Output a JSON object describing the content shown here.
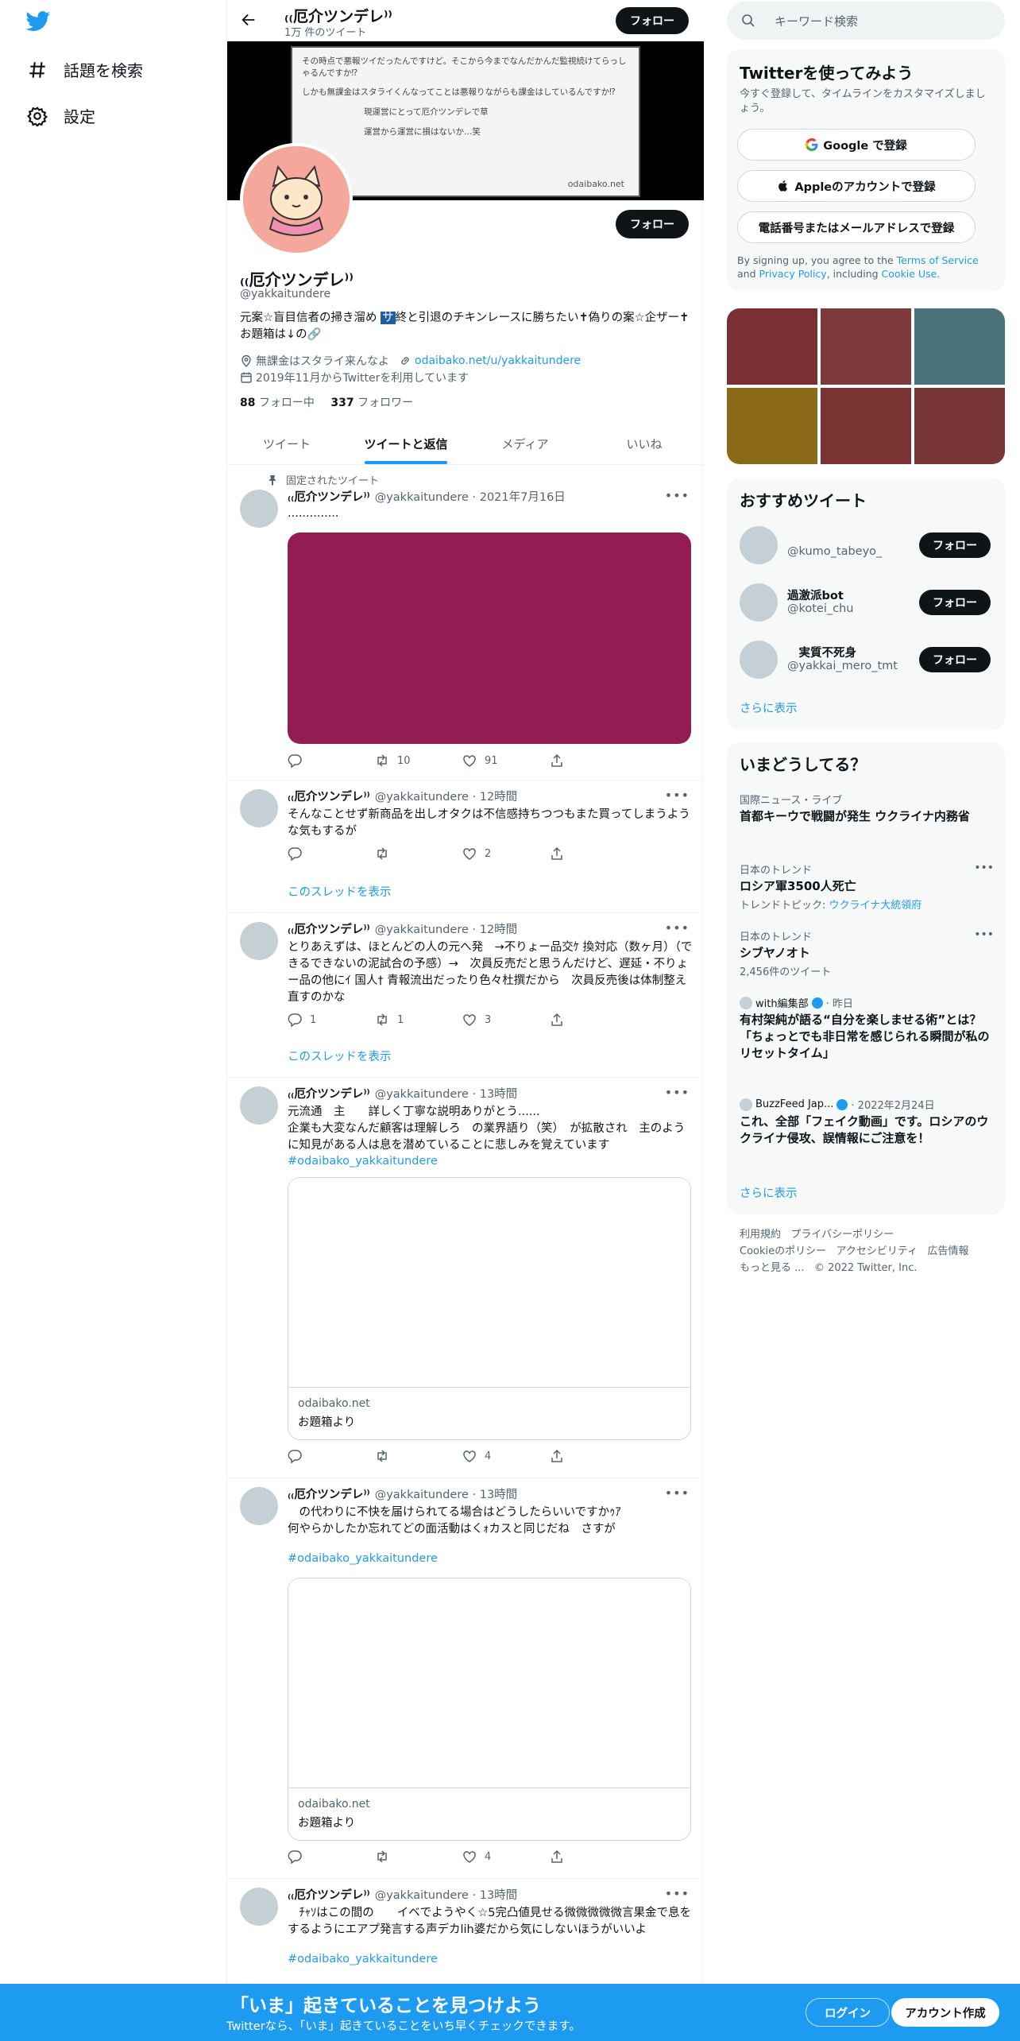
{
  "nav": {
    "explore": "話題を検索",
    "settings": "設定"
  },
  "header": {
    "name": "₍₍厄介ツンデレ⁾⁾",
    "tweet_count": "1万 件のツイート",
    "follow": "フォロー"
  },
  "banner": {
    "line1": "その時点で悪報ツイだったんですけど。そこから今までなんだかんだ監視続けてらっしゃるんですか⁉",
    "line2": "しかも無課金はスタライくんなってことは悪報りながらも課金はしているんですか⁉",
    "line3": "現運営にとって厄介ツンデレで草",
    "line4": "運営から運営に損はないか…笑",
    "url": "odaibako.net"
  },
  "profile": {
    "name": "₍₍厄介ツンデレ⁾⁾",
    "handle": "@yakkaitundere",
    "follow": "フォロー",
    "bio_before": "元案☆盲目信者の掃き溜め ",
    "bio_mark": "サ",
    "bio_after": "終と引退のチキンレースに勝ちたい✝偽りの案☆企ザー✝ お題箱は↓の🔗",
    "location": "無課金はスタライ来んなよ",
    "link": "odaibako.net/u/yakkaitundere",
    "joined": "2019年11月からTwitterを利用しています",
    "following_count": "88",
    "following_label": "フォロー中",
    "followers_count": "337",
    "followers_label": "フォロワー"
  },
  "tabs": [
    "ツイート",
    "ツイートと返信",
    "メディア",
    "いいね"
  ],
  "tweets": [
    {
      "pinned_label": "固定されたツイート",
      "name": "₍₍厄介ツンデレ⁾⁾",
      "meta": "@yakkaitundere · 2021年7月16日",
      "text": "..............",
      "retweets": "10",
      "likes": "91",
      "media_color": "#931d52"
    },
    {
      "name": "₍₍厄介ツンデレ⁾⁾",
      "meta": "@yakkaitundere · 12時間",
      "text": "そんなことせず新商品を出しオタクは不信感持ちつつもまた買ってしまうような気もするが",
      "likes": "2",
      "thread": "このスレッドを表示"
    },
    {
      "name": "₍₍厄介ツンデレ⁾⁾",
      "meta": "@yakkaitundere · 12時間",
      "text": "とりあえずは、ほとんどの人の元へ発　→不りょー品交ｹ 換対応（数ヶ月）（できるできないの泥試合の予感）→　次員反売だと思うんだけど、遅延・不りょー品の他にｲ 国人† 青報流出だったり色々杜撰だから　次員反売後は体制整え直すのかな",
      "replies": "1",
      "retweets": "1",
      "likes": "3",
      "thread": "このスレッドを表示"
    },
    {
      "name": "₍₍厄介ツンデレ⁾⁾",
      "meta": "@yakkaitundere · 13時間",
      "text": "元流通　主　　詳しく丁寧な説明ありがとう......\n企業も大変なんだ顧客は理解しろ　の業界語り（笑）　が拡散され　主のように知見がある人は息を潜めていることに悲しみを覚えています",
      "hashtag": "#odaibako_yakkaitundere",
      "card_domain": "odaibako.net",
      "card_title": "お題箱より",
      "likes": "4"
    },
    {
      "name": "₍₍厄介ツンデレ⁾⁾",
      "meta": "@yakkaitundere · 13時間",
      "text": "　の代わりに不快を届けられてる場合はどうしたらいいですかｩｱ\n何やらかしたか忘れてどの面活動はくｫカスと同じだね　さすが",
      "hashtag": "#odaibako_yakkaitundere",
      "card_domain": "odaibako.net",
      "card_title": "お題箱より",
      "likes": "4"
    },
    {
      "name": "₍₍厄介ツンデレ⁾⁾",
      "meta": "@yakkaitundere · 13時間",
      "text": "　ﾁｬｿはこの間の　　イベでようやく☆5完凸値見せる微微微微微言果金で息をするようにエアプ発言する声デカlih婆だから気にしないほうがいいよ",
      "hashtag": "#odaibako_yakkaitundere"
    }
  ],
  "right": {
    "search_placeholder": "キーワード検索",
    "signup_title": "Twitterを使ってみよう",
    "signup_desc": "今すぐ登録して、タイムラインをカスタマイズしましょう。",
    "google_btn": "Google で登録",
    "apple_btn": "Appleのアカウントで登録",
    "phone_btn": "電話番号またはメールアドレスで登録",
    "terms_prefix": "By signing up, you agree to the ",
    "terms": "Terms of Service",
    "terms_and": " and ",
    "privacy": "Privacy Policy",
    "terms_including": ", including ",
    "cookie": "Cookie Use.",
    "gallery_colors": [
      "#7b2f34",
      "#7e3a3a",
      "#4a7278",
      "#8a6a18",
      "#7a3333",
      "#773535"
    ],
    "rec_title": "おすすめツイート",
    "recs": [
      {
        "name": "",
        "handle": "@kumo_tabeyo_"
      },
      {
        "name": "過激派bot",
        "handle": "@kotei_chu"
      },
      {
        "name": "　実質不死身",
        "handle": "@yakkai_mero_tmt"
      }
    ],
    "follow": "フォロー",
    "show_more": "さらに表示",
    "trends_title": "いまどうしてる？",
    "trends": [
      {
        "cat": "国際ニュース・ライブ",
        "title": "首都キーウで戦闘が発生 ウクライナ内務省"
      },
      {
        "cat": "日本のトレンド",
        "title": "ロシア軍3500人死亡",
        "sub_prefix": "トレンドトピック: ",
        "sub_link": "ウクライナ大統領府"
      },
      {
        "cat": "日本のトレンド",
        "title": "シブヤノオト",
        "sub": "2,456件のツイート"
      },
      {
        "src": "with編集部",
        "time": "· 昨日",
        "title": "有村架純が語る“自分を楽しませる術”とは？「ちょっとでも非日常を感じられる瞬間が私のリセットタイム」"
      },
      {
        "src": "BuzzFeed Jap...",
        "time": "· 2022年2月24日",
        "title": "これ、全部「フェイク動画」です。ロシアのウクライナ侵攻、誤情報にご注意を！"
      }
    ],
    "footer": {
      "terms": "利用規約",
      "privacy": "プライバシーポリシー",
      "cookie": "Cookieのポリシー",
      "access": "アクセシビリティ",
      "ads": "広告情報",
      "more": "もっと見る ...",
      "copy": "© 2022 Twitter, Inc."
    }
  },
  "bottom": {
    "title": "「いま」起きていることを見つけよう",
    "subtitle": "Twitterなら、「いま」起きていることをいち早くチェックできます。",
    "login": "ログイン",
    "signup": "アカウント作成"
  }
}
